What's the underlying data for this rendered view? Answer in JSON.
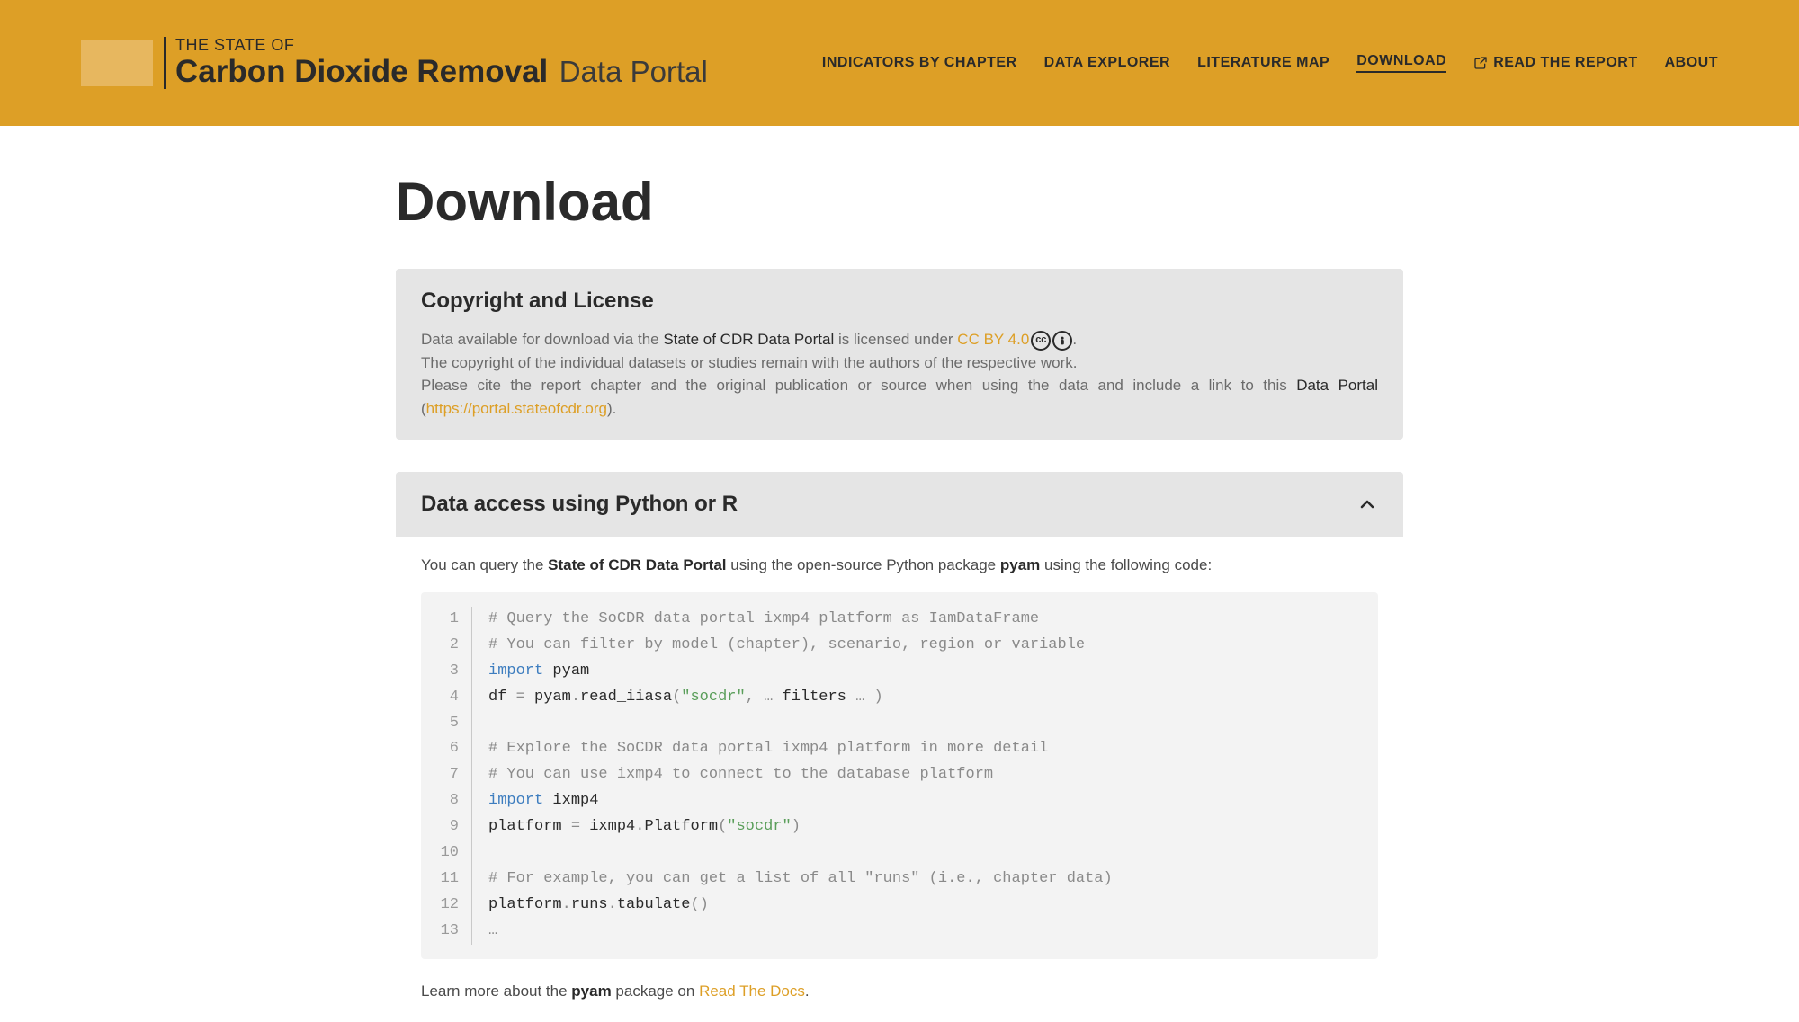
{
  "header": {
    "logo": {
      "line1": "THE STATE OF",
      "line2": "Carbon Dioxide Removal",
      "line3": "Data Portal"
    },
    "nav": [
      {
        "label": "INDICATORS BY CHAPTER",
        "key": "indicators",
        "active": false,
        "ext": false
      },
      {
        "label": "DATA EXPLORER",
        "key": "explorer",
        "active": false,
        "ext": false
      },
      {
        "label": "LITERATURE MAP",
        "key": "litmap",
        "active": false,
        "ext": false
      },
      {
        "label": "DOWNLOAD",
        "key": "download",
        "active": true,
        "ext": false
      },
      {
        "label": "READ THE REPORT",
        "key": "report",
        "active": false,
        "ext": true
      },
      {
        "label": "ABOUT",
        "key": "about",
        "active": false,
        "ext": false
      }
    ]
  },
  "page": {
    "title": "Download"
  },
  "copyright": {
    "title": "Copyright and License",
    "p1_pre": "Data available for download via the ",
    "p1_bold": "State of CDR Data Portal",
    "p1_mid": " is licensed under ",
    "p1_link": "CC BY 4.0",
    "p1_post": ".",
    "p2": "The copyright of the individual datasets or studies remain with the authors of the respective work.",
    "p3_pre": "Please cite the report chapter and the original publication or source when using the data and include a link to this ",
    "p3_bold": "Data Portal",
    "p3_mid": " (",
    "p3_link": "https://portal.stateofcdr.org",
    "p3_post": ")."
  },
  "access": {
    "title": "Data access using Python or R",
    "intro_pre": "You can query the ",
    "intro_bold1": "State of CDR Data Portal",
    "intro_mid": " using the open-source Python package ",
    "intro_bold2": "pyam",
    "intro_post": " using the following code:",
    "code_lines": [
      {
        "type": "comment",
        "text": "# Query the SoCDR data portal ixmp4 platform as IamDataFrame"
      },
      {
        "type": "comment",
        "text": "# You can filter by model (chapter), scenario, region or variable"
      },
      {
        "type": "import",
        "kw": "import",
        "rest": " pyam"
      },
      {
        "type": "assign",
        "pre": "df ",
        "op": "=",
        "mid": " pyam",
        "dot": ".",
        "fn": "read_iiasa",
        "lp": "(",
        "str": "\"socdr\"",
        "c1": ",",
        "ell1": " … ",
        "arg": "filters",
        "ell2": " … ",
        "rp": ")"
      },
      {
        "type": "blank",
        "text": ""
      },
      {
        "type": "comment",
        "text": "# Explore the SoCDR data portal ixmp4 platform in more detail"
      },
      {
        "type": "comment",
        "text": "# You can use ixmp4 to connect to the database platform"
      },
      {
        "type": "import",
        "kw": "import",
        "rest": " ixmp4"
      },
      {
        "type": "assign2",
        "pre": "platform ",
        "op": "=",
        "mid": " ixmp4",
        "dot": ".",
        "fn": "Platform",
        "lp": "(",
        "str": "\"socdr\"",
        "rp": ")"
      },
      {
        "type": "blank",
        "text": ""
      },
      {
        "type": "comment",
        "text": "# For example, you can get a list of all \"runs\" (i.e., chapter data)"
      },
      {
        "type": "call",
        "pre": "platform",
        "d1": ".",
        "m1": "runs",
        "d2": ".",
        "m2": "tabulate",
        "lp": "(",
        "rp": ")"
      },
      {
        "type": "ell",
        "text": "…"
      }
    ],
    "outro_pre": "Learn more about the ",
    "outro_bold": "pyam",
    "outro_mid": " package on ",
    "outro_link": "Read The Docs",
    "outro_post": "."
  }
}
